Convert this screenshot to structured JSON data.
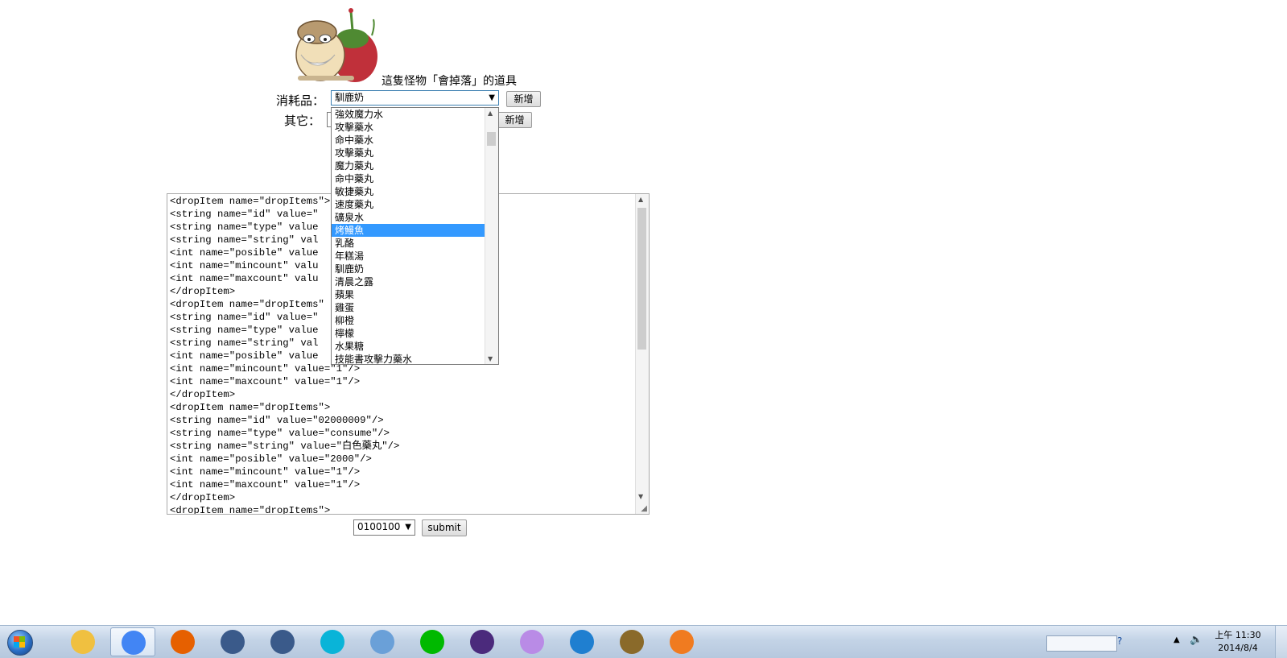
{
  "monster": {
    "caption": "這隻怪物「會掉落」的道具"
  },
  "consumable": {
    "label": "消耗品：",
    "selected": "馴鹿奶",
    "add_button": "新增"
  },
  "other": {
    "label": "其它：",
    "add_button": "新增"
  },
  "dropdown_items": [
    "強效魔力水",
    "攻擊藥水",
    "命中藥水",
    "攻擊藥丸",
    "魔力藥丸",
    "命中藥丸",
    "敏捷藥丸",
    "速度藥丸",
    "礦泉水",
    "烤鰻魚",
    "乳酪",
    "年糕湯",
    "馴鹿奶",
    "清晨之露",
    "蘋果",
    "雞蛋",
    "柳橙",
    "檸檬",
    "水果糖",
    "技能書攻擊力藥水"
  ],
  "dropdown_highlighted": "烤鰻魚",
  "xml_lines": [
    "<dropItem name=\"dropItems\">",
    "<string name=\"id\" value=\"",
    "<string name=\"type\" value",
    "<string name=\"string\" val",
    "<int name=\"posible\" value",
    "<int name=\"mincount\" valu",
    "<int name=\"maxcount\" valu",
    "</dropItem>",
    "<dropItem name=\"dropItems\"",
    "<string name=\"id\" value=\"",
    "<string name=\"type\" value",
    "<string name=\"string\" val",
    "<int name=\"posible\" value",
    "<int name=\"mincount\" value=\"1\"/>",
    "<int name=\"maxcount\" value=\"1\"/>",
    "</dropItem>",
    "<dropItem name=\"dropItems\">",
    "<string name=\"id\" value=\"02000009\"/>",
    "<string name=\"type\" value=\"consume\"/>",
    "<string name=\"string\" value=\"白色藥丸\"/>",
    "<int name=\"posible\" value=\"2000\"/>",
    "<int name=\"mincount\" value=\"1\"/>",
    "<int name=\"maxcount\" value=\"1\"/>",
    "</dropItem>",
    "<dropItem name=\"dropItems\">"
  ],
  "footer": {
    "id_select": "0100100",
    "submit_label": "submit"
  },
  "taskbar": {
    "apps": [
      {
        "icon": "file-explorer-icon",
        "color": "#f0c040"
      },
      {
        "icon": "chrome-icon",
        "color": "#4285f4"
      },
      {
        "icon": "firefox-icon",
        "color": "#e66000"
      },
      {
        "icon": "starcraft2-icon",
        "color": "#3a5a8a"
      },
      {
        "icon": "starcraft2-icon",
        "color": "#3a5a8a"
      },
      {
        "icon": "kkbox-icon",
        "color": "#09b4d8"
      },
      {
        "icon": "virtualbox-icon",
        "color": "#6aa0d8"
      },
      {
        "icon": "line-icon",
        "color": "#00b900"
      },
      {
        "icon": "eclipse-icon",
        "color": "#4b2a7c"
      },
      {
        "icon": "flower-app-icon",
        "color": "#b98be6"
      },
      {
        "icon": "media-player-icon",
        "color": "#1f7fd0"
      },
      {
        "icon": "hearthstone-icon",
        "color": "#8a6a2a"
      },
      {
        "icon": "xampp-icon",
        "color": "#f07b20"
      }
    ],
    "clock_time": "上午 11:30",
    "clock_date": "2014/8/4"
  }
}
